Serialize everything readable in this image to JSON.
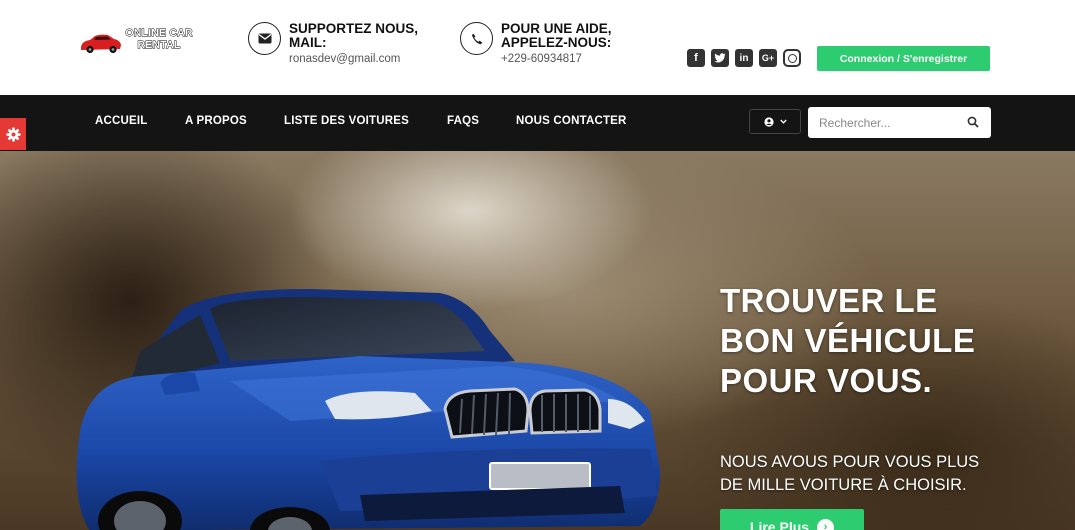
{
  "brand": {
    "logo_text": "ONLINE CAR RENTAL"
  },
  "header": {
    "email_block": {
      "title": "SUPPORTEZ NOUS, MAIL:",
      "value": "ronasdev@gmail.com",
      "icon": "envelope-icon"
    },
    "phone_block": {
      "title": "POUR UNE AIDE, APPELEZ-NOUS:",
      "value": "+229-60934817",
      "icon": "phone-icon"
    },
    "social": [
      "facebook-icon",
      "twitter-icon",
      "linkedin-icon",
      "google-plus-icon",
      "instagram-icon"
    ],
    "login_label": "Connexion / S'enregistrer"
  },
  "nav": {
    "items": [
      {
        "label": "ACCUEIL"
      },
      {
        "label": "A PROPOS"
      },
      {
        "label": "LISTE DES VOITURES"
      },
      {
        "label": "FAQS"
      },
      {
        "label": "NOUS CONTACTER"
      }
    ],
    "search_placeholder": "Rechercher..."
  },
  "hero": {
    "title": "TROUVER LE BON VÉHICULE POUR VOUS.",
    "subtitle": "NOUS AVOUS POUR VOUS PLUS DE MILLE VOITURE À CHOISIR.",
    "cta_label": "Lire Plus"
  },
  "colors": {
    "accent": "#2ecc71",
    "nav_bg": "#141414",
    "gear_tab": "#e53935"
  }
}
